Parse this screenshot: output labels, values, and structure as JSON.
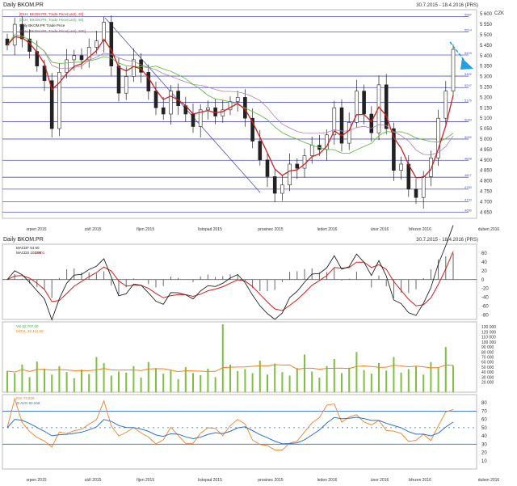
{
  "window": {
    "title": "Daily BKOM.PR",
    "range": "30.7.2015 - 18.4.2016 (PRS)",
    "currency": "CZK"
  },
  "legend_main": [
    {
      "text": "[D1H, BKOM.PR, Trade Price(Last), 20]",
      "color": "#d02020"
    },
    {
      "text": "[D1H, BKOM.PR, Trade Price(Last), 50]",
      "color": "#40b040"
    },
    {
      "text": "Daily BKOM.PR Trade Price",
      "color": "#222222"
    },
    {
      "text": "[D1H, BKOM.PR, Trade Price(Last), 200]",
      "color": "#a040a0"
    }
  ],
  "legend_macd": [
    {
      "text": "MACDF 54.60",
      "color": "#222222"
    },
    {
      "text": "MACDS 101.88",
      "color": "#222222"
    },
    {
      "text": "90.01",
      "color": "#e02020"
    }
  ],
  "legend_vol": [
    {
      "text": "Vol 52 707.00",
      "color": "#40b040"
    },
    {
      "text": "MOVL 49 411.50",
      "color": "#f08020"
    }
  ],
  "legend_rsi": [
    {
      "text": "RSI 73.839",
      "color": "#f08020"
    },
    {
      "text": "SI AVG 60.268",
      "color": "#3070d0"
    }
  ],
  "months": [
    "srpen 2015",
    "září 2015",
    "říjen 2015",
    "listopad 2015",
    "prosinec 2015",
    "leden 2016",
    "únor 2016",
    "březen 2016",
    "duben 2016"
  ],
  "colors": {
    "grid_line": "#5050c0",
    "ma20": "#d02020",
    "ma50": "#60c040",
    "ma200": "#b080b0",
    "arrow": "#20a0e0",
    "volume": "#80c040",
    "rsi": "#f08020",
    "rsi_avg": "#3070d0"
  },
  "chart_data": [
    {
      "type": "candlestick",
      "title": "Daily BKOM.PR",
      "ylim": [
        4620,
        5620
      ],
      "yticks": [
        5600,
        5550,
        5500,
        5450,
        5400,
        5350,
        5300,
        5250,
        5200,
        5150,
        5100,
        5050,
        5000,
        4950,
        4900,
        4850,
        4800,
        4750,
        4700,
        4650
      ],
      "levels": [
        5587,
        5514,
        5403,
        5302,
        5247,
        5176,
        5083,
        5000,
        4898,
        4817,
        4760,
        4700,
        4650
      ],
      "closes": [
        5450,
        5550,
        5480,
        5420,
        5350,
        5280,
        5050,
        5320,
        5380,
        5400,
        5380,
        5440,
        5470,
        5560,
        5350,
        5220,
        5300,
        5380,
        5320,
        5230,
        5150,
        5120,
        5230,
        5160,
        5120,
        5060,
        5140,
        5150,
        5110,
        5140,
        5180,
        5200,
        5100,
        4990,
        4900,
        4820,
        4740,
        4780,
        4880,
        4860,
        4920,
        4970,
        4950,
        5020,
        5150,
        4980,
        5080,
        5230,
        5120,
        5030,
        5260,
        5050,
        4850,
        4880,
        4760,
        4720,
        4820,
        4910,
        5100,
        5230,
        5430
      ],
      "ma_periods": [
        20,
        50,
        200
      ]
    },
    {
      "type": "line",
      "title": "MACD",
      "ylim": [
        -90,
        80
      ],
      "yticks": [
        60,
        40,
        20,
        0,
        -20,
        -40,
        -60,
        -80
      ]
    },
    {
      "type": "bar",
      "title": "Volume",
      "ylim": [
        0,
        140000
      ],
      "yticks": [
        130000,
        120000,
        110000,
        100000,
        90000,
        80000,
        70000,
        60000,
        50000,
        40000,
        30000,
        20000
      ],
      "values": [
        42000,
        38000,
        55000,
        30000,
        61000,
        47000,
        35000,
        52000,
        40000,
        28000,
        45000,
        36000,
        70000,
        58000,
        33000,
        41000,
        39000,
        52000,
        29000,
        60000,
        48000,
        37000,
        44000,
        26000,
        50000,
        38000,
        34000,
        47000,
        30000,
        135000,
        55000,
        42000,
        46000,
        38000,
        63000,
        35000,
        57000,
        40000,
        33000,
        48000,
        75000,
        41000,
        29000,
        52000,
        66000,
        38000,
        49000,
        80000,
        44000,
        37000,
        58000,
        43000,
        70000,
        39000,
        46000,
        52000,
        35000,
        60000,
        48000,
        90000,
        52707
      ]
    },
    {
      "type": "line",
      "title": "RSI",
      "ylim": [
        0,
        90
      ],
      "yticks": [
        80,
        70,
        60,
        50,
        40,
        30,
        20,
        10
      ],
      "levels": [
        70,
        50,
        30
      ]
    }
  ]
}
